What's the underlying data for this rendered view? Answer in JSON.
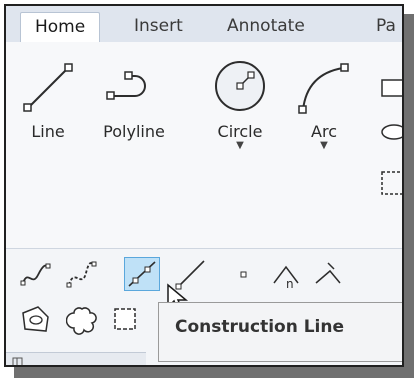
{
  "tabs": [
    {
      "label": "Home",
      "active": true
    },
    {
      "label": "Insert",
      "active": false
    },
    {
      "label": "Annotate",
      "active": false
    },
    {
      "label": "Pa",
      "active": false
    }
  ],
  "draw_panel": {
    "large_tools": [
      {
        "label": "Line",
        "icon": "line-icon",
        "has_dropdown": false
      },
      {
        "label": "Polyline",
        "icon": "polyline-icon",
        "has_dropdown": false
      },
      {
        "label": "Circle",
        "icon": "circle-icon",
        "has_dropdown": true
      },
      {
        "label": "Arc",
        "icon": "arc-icon",
        "has_dropdown": true
      }
    ],
    "small_tools_row1": [
      "spline-fit-icon",
      "spline-cv-icon",
      "construction-line-icon",
      "ray-icon",
      "point-icon",
      "divide-icon",
      "measure-icon"
    ],
    "small_tools_row2": [
      "region-icon",
      "revision-cloud-icon",
      "wipeout-icon"
    ]
  },
  "tooltip": {
    "text": "Construction Line"
  },
  "colors": {
    "tab_bar": "#dfe5ee",
    "selected_fill": "#bfe1f7",
    "selected_border": "#5aa7dc",
    "icon_stroke": "#2d2d2d"
  }
}
